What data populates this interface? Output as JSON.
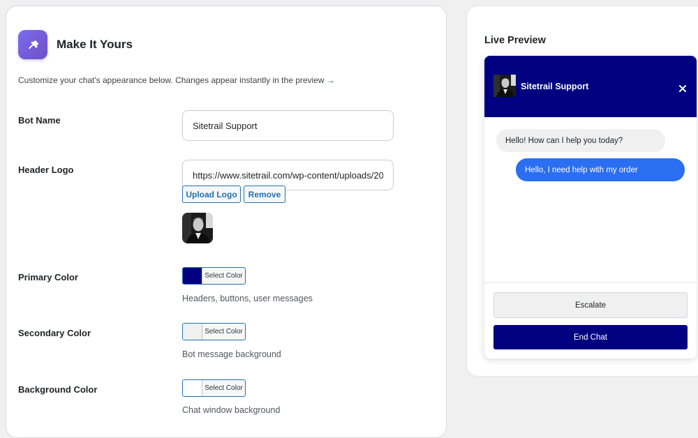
{
  "header": {
    "title": "Make It Yours",
    "icon": "pin-icon",
    "subtitle": "Customize your chat's appearance below. Changes appear instantly in the preview →"
  },
  "fields": {
    "bot_name": {
      "label": "Bot Name",
      "value": "Sitetrail Support"
    },
    "header_logo": {
      "label": "Header Logo",
      "value": "https://www.sitetrail.com/wp-content/uploads/2025",
      "upload_label": "Upload Logo",
      "remove_label": "Remove"
    },
    "primary_color": {
      "label": "Primary Color",
      "button_label": "Select Color",
      "color": "#000080",
      "help": "Headers, buttons, user messages"
    },
    "secondary_color": {
      "label": "Secondary Color",
      "button_label": "Select Color",
      "color": "#f0f0f1",
      "help": "Bot message background"
    },
    "background_color": {
      "label": "Background Color",
      "button_label": "Select Color",
      "color": "#ffffff",
      "help": "Chat window background"
    }
  },
  "preview": {
    "title": "Live Preview",
    "bot_name": "Sitetrail Support",
    "bot_message": "Hello! How can I help you today?",
    "user_message": "Hello, I need help with my order",
    "escalate_label": "Escalate",
    "end_chat_label": "End Chat",
    "header_color": "#000080",
    "user_bubble_color": "#2a6ef2"
  }
}
